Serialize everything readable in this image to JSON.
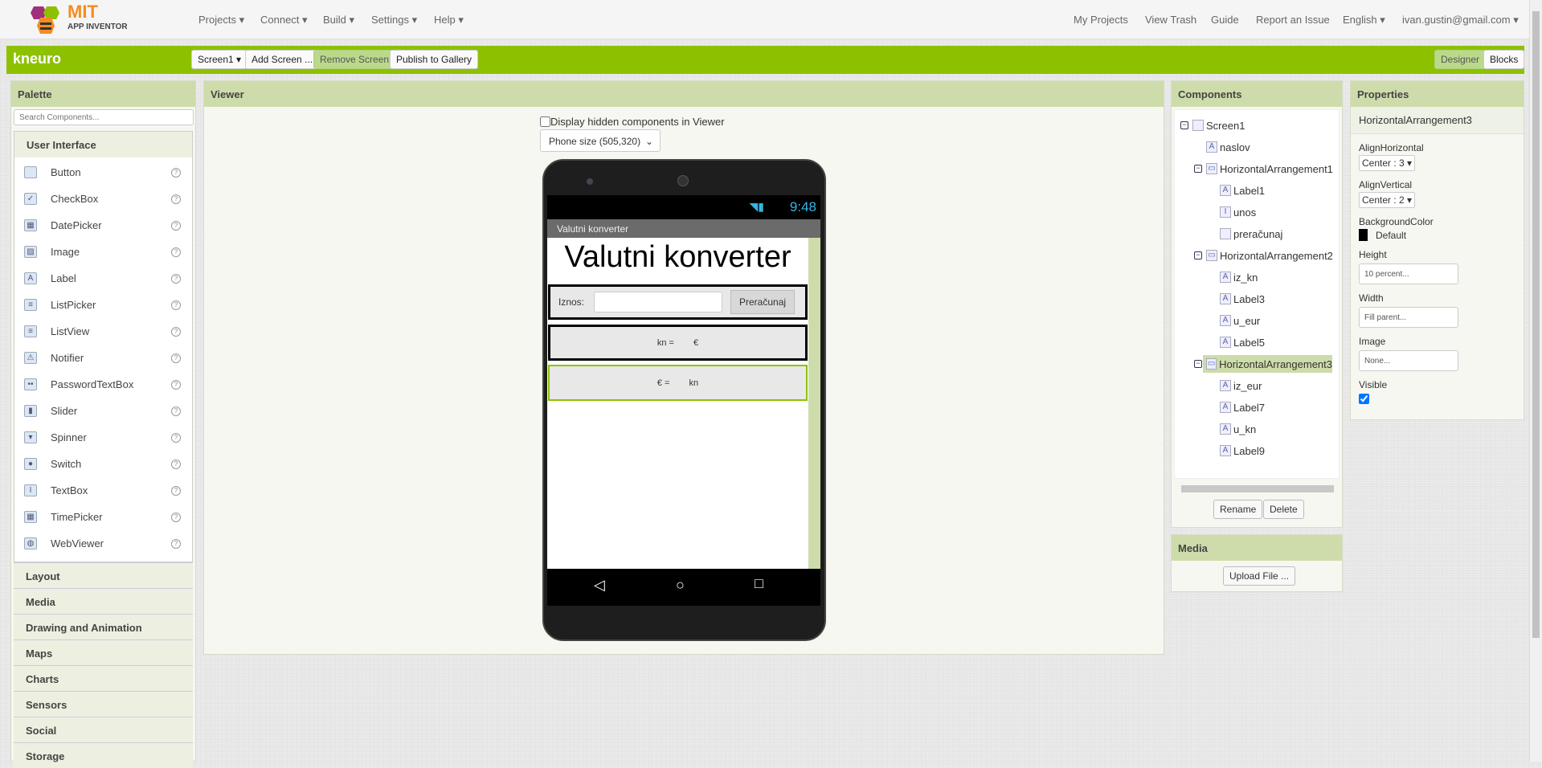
{
  "topbar": {
    "logo_line1": "MIT",
    "logo_line2": "APP INVENTOR",
    "menus": [
      "Projects ▾",
      "Connect ▾",
      "Build ▾",
      "Settings ▾",
      "Help ▾"
    ],
    "right": [
      "My Projects",
      "View Trash",
      "Guide",
      "Report an Issue",
      "English ▾",
      "ivan.gustin@gmail.com ▾"
    ]
  },
  "toolbar": {
    "project": "kneuro",
    "screen": "Screen1 ▾",
    "add_screen": "Add Screen ...",
    "remove_screen": "Remove Screen",
    "publish": "Publish to Gallery",
    "designer": "Designer",
    "blocks": "Blocks"
  },
  "palette": {
    "title": "Palette",
    "search_placeholder": "Search Components...",
    "open_category": "User Interface",
    "items": [
      "Button",
      "CheckBox",
      "DatePicker",
      "Image",
      "Label",
      "ListPicker",
      "ListView",
      "Notifier",
      "PasswordTextBox",
      "Slider",
      "Spinner",
      "Switch",
      "TextBox",
      "TimePicker",
      "WebViewer"
    ],
    "help": "?",
    "categories": [
      "Layout",
      "Media",
      "Drawing and Animation",
      "Maps",
      "Charts",
      "Sensors",
      "Social",
      "Storage"
    ]
  },
  "viewer": {
    "title": "Viewer",
    "hidden_checkbox": "Display hidden components in Viewer",
    "size_select": "Phone size (505,320)",
    "phone": {
      "time": "9:48",
      "app_title": "Valutni konverter",
      "heading": "Valutni konverter",
      "iznos_label": "Iznos:",
      "input_value": "",
      "button": "Preračunaj",
      "row2": [
        "kn =",
        "€"
      ],
      "row3": [
        "€ =",
        "kn"
      ]
    }
  },
  "components": {
    "title": "Components",
    "tree": [
      {
        "name": "Screen1",
        "level": 0,
        "icon": "screen",
        "toggle": true
      },
      {
        "name": "naslov",
        "level": 1,
        "icon": "label"
      },
      {
        "name": "HorizontalArrangement1",
        "level": 1,
        "icon": "arrangement",
        "toggle": true
      },
      {
        "name": "Label1",
        "level": 2,
        "icon": "label"
      },
      {
        "name": "unos",
        "level": 2,
        "icon": "textbox"
      },
      {
        "name": "preračunaj",
        "level": 2,
        "icon": "button"
      },
      {
        "name": "HorizontalArrangement2",
        "level": 1,
        "icon": "arrangement",
        "toggle": true
      },
      {
        "name": "iz_kn",
        "level": 2,
        "icon": "label"
      },
      {
        "name": "Label3",
        "level": 2,
        "icon": "label"
      },
      {
        "name": "u_eur",
        "level": 2,
        "icon": "label"
      },
      {
        "name": "Label5",
        "level": 2,
        "icon": "label"
      },
      {
        "name": "HorizontalArrangement3",
        "level": 1,
        "icon": "arrangement",
        "toggle": true,
        "selected": true
      },
      {
        "name": "iz_eur",
        "level": 2,
        "icon": "label"
      },
      {
        "name": "Label7",
        "level": 2,
        "icon": "label"
      },
      {
        "name": "u_kn",
        "level": 2,
        "icon": "label"
      },
      {
        "name": "Label9",
        "level": 2,
        "icon": "label"
      }
    ],
    "rename": "Rename",
    "delete": "Delete"
  },
  "media": {
    "title": "Media",
    "upload": "Upload File ..."
  },
  "properties": {
    "title": "Properties",
    "component": "HorizontalArrangement3",
    "align_h_label": "AlignHorizontal",
    "align_h": "Center : 3 ▾",
    "align_v_label": "AlignVertical",
    "align_v": "Center : 2 ▾",
    "bg_label": "BackgroundColor",
    "bg_value": "Default",
    "height_label": "Height",
    "height": "10 percent...",
    "width_label": "Width",
    "width": "Fill parent...",
    "image_label": "Image",
    "image": "None...",
    "visible_label": "Visible",
    "visible": true
  },
  "colors": {
    "green": "#8dc100",
    "panel_header": "#cddcaa",
    "selected": "#cddcaa"
  }
}
